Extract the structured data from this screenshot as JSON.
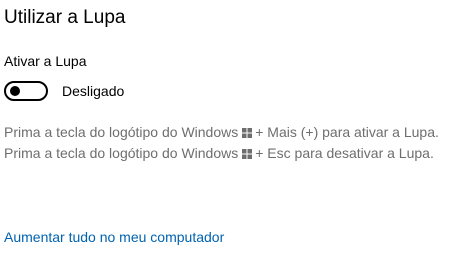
{
  "page": {
    "title": "Utilizar a Lupa"
  },
  "magnifier_toggle": {
    "label": "Ativar a Lupa",
    "state_text": "Desligado",
    "value": false
  },
  "instructions": {
    "line1_before": "Prima a tecla do logótipo do Windows",
    "line1_after": "+ Mais (+) para ativar a Lupa.",
    "line2_before": "Prima a tecla do logótipo do Windows",
    "line2_after": "+ Esc para desativar a Lupa.",
    "icon": "windows-logo-icon"
  },
  "link": {
    "text": "Aumentar tudo no meu computador"
  },
  "colors": {
    "link": "#0063b1",
    "secondary_text": "#6e6e6e",
    "text": "#000000",
    "background": "#ffffff"
  }
}
